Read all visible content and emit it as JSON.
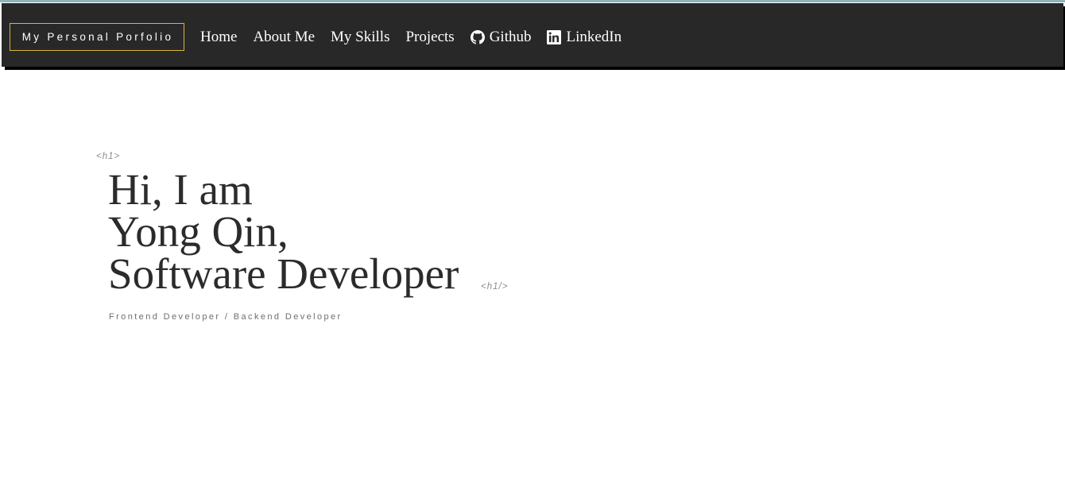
{
  "nav": {
    "brand": "My Personal Porfolio",
    "links": [
      {
        "label": "Home"
      },
      {
        "label": "About Me"
      },
      {
        "label": "My Skills"
      },
      {
        "label": "Projects"
      },
      {
        "label": "Github",
        "icon": "github-icon"
      },
      {
        "label": "LinkedIn",
        "icon": "linkedin-icon"
      }
    ]
  },
  "hero": {
    "tag_open": "<h1>",
    "tag_close": "<h1/>",
    "headline_lines": [
      "Hi, I am",
      "Yong Qin,",
      "Software Developer"
    ],
    "subtitle": "Frontend Developer / Backend Developer"
  },
  "colors": {
    "navbar_bg": "#282828",
    "brand_border": "#d9b536",
    "heading_text": "#2b2b2b",
    "muted_text": "#8e8e8e"
  }
}
